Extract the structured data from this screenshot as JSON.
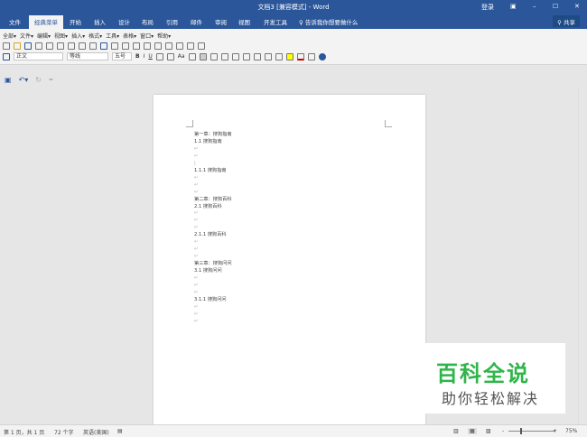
{
  "titlebar": {
    "title": "文档3 [兼容模式] - Word",
    "login": "登录",
    "ribbon_opts": "▣",
    "minimize": "–",
    "maximize": "☐",
    "close": "✕"
  },
  "tabs": [
    "文件",
    "经典菜单",
    "开始",
    "插入",
    "设计",
    "布局",
    "引用",
    "邮件",
    "审阅",
    "视图",
    "开发工具"
  ],
  "tell_me": "告诉我你想要做什么",
  "share": "共享",
  "menu": [
    "全部▾",
    "文件▾",
    "编辑▾",
    "视图▾",
    "插入▾",
    "格式▾",
    "工具▾",
    "表格▾",
    "窗口▾",
    "帮助▾"
  ],
  "format": {
    "style": "正文",
    "font": "等线",
    "size": "五号",
    "bold": "B",
    "italic": "I",
    "underline": "U",
    "case": "Aa"
  },
  "document": {
    "lines": [
      "第一章：搜狗指南",
      "1.1 搜狗指南",
      "↵",
      "↵",
      "|",
      "1.1.1 搜狗指南",
      "↵",
      "↵",
      "↵",
      "第二章：搜狗百科",
      "2.1 搜狗百科",
      "↵",
      "↵",
      "↵",
      "2.1.1 搜狗百科",
      "↵",
      "↵",
      "↵",
      "第三章：搜狗问问",
      "3.1 搜狗问问",
      "↵",
      "↵",
      "↵",
      "3.1.1 搜狗问问",
      "↵",
      "↵",
      "↵"
    ]
  },
  "status": {
    "page": "第 1 页，共 1 页",
    "words": "72 个字",
    "lang": "英语(美国)",
    "zoom": "75%",
    "zoom_minus": "-",
    "zoom_plus": "+"
  },
  "watermark": {
    "line1": "百科全说",
    "line2": "助你轻松解决"
  }
}
